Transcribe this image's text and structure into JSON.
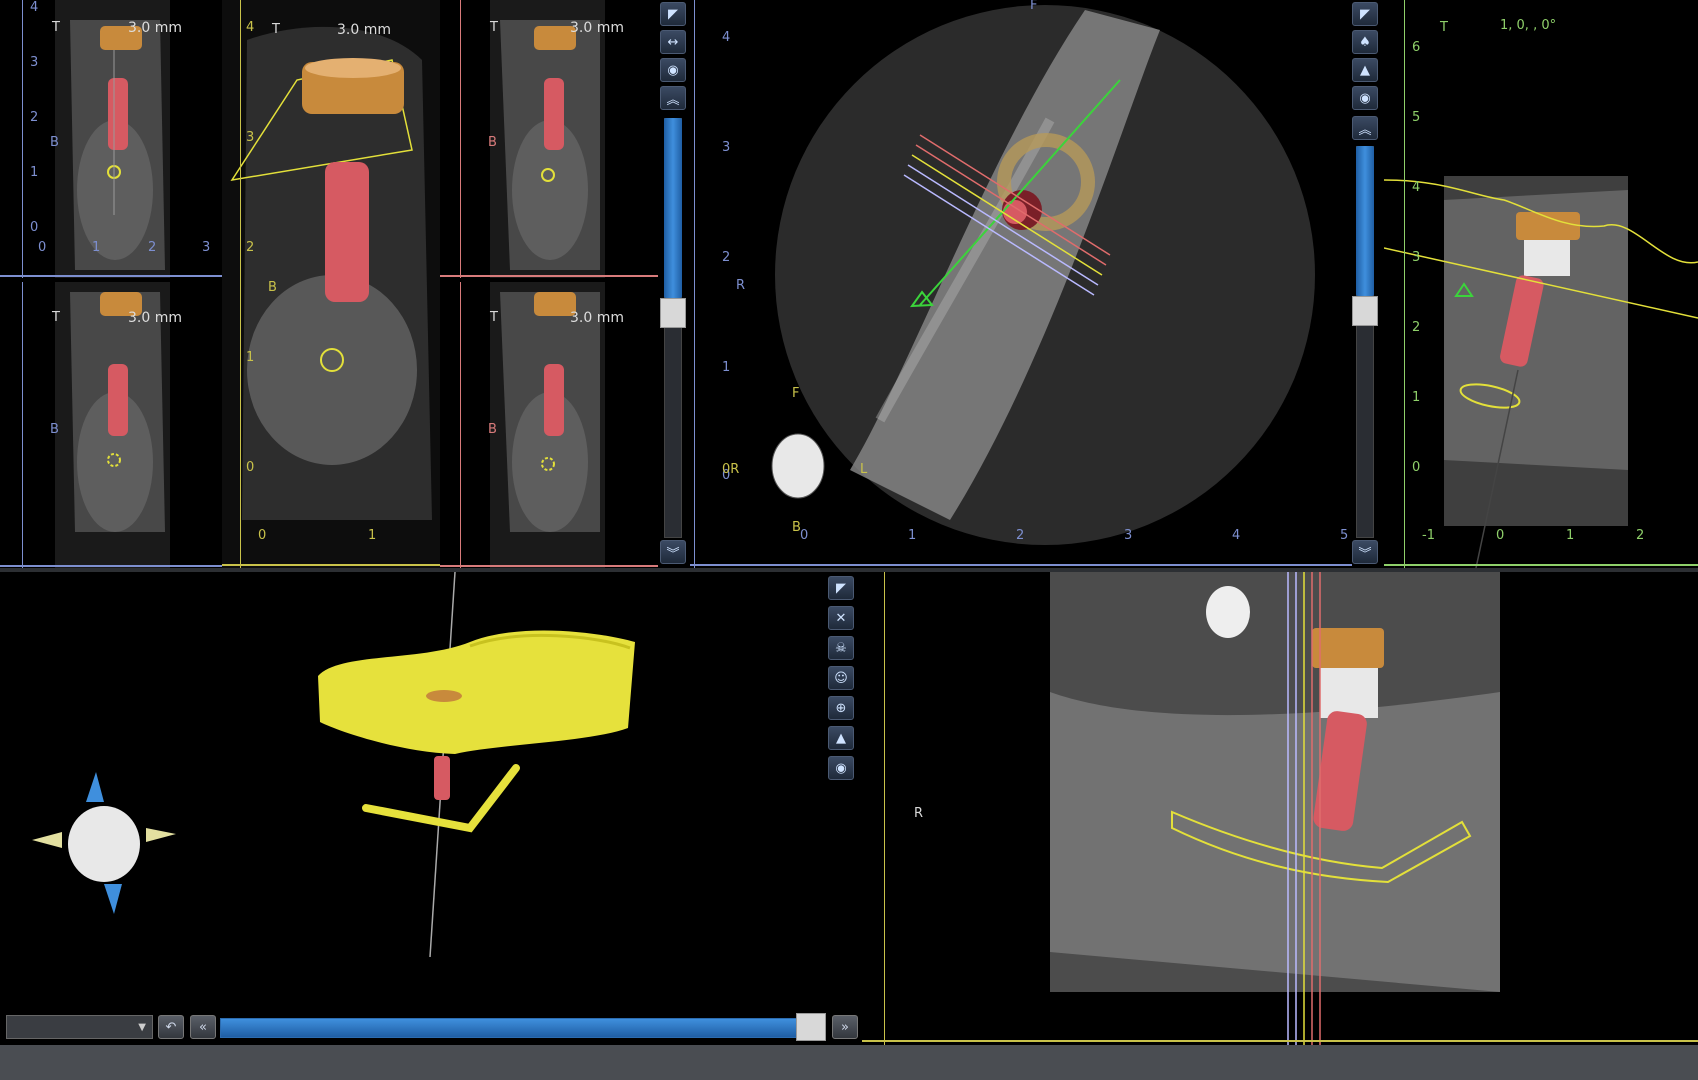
{
  "views": {
    "cross1": {
      "top_label": "T",
      "mm": "3.0 mm",
      "side_label": "B"
    },
    "cross_main": {
      "top_label": "T",
      "mm": "3.0 mm",
      "side_label": "B"
    },
    "cross3": {
      "top_label": "T",
      "mm": "3.0 mm",
      "side_label": "B"
    },
    "cross4": {
      "top_label": "T",
      "mm": "3.0 mm",
      "side_label": "B"
    },
    "cross5": {
      "top_label": "T",
      "mm": "3.0 mm",
      "side_label": "B"
    },
    "axial": {
      "top": "F",
      "right": "R",
      "orient_f": "F",
      "orient_r": "0R",
      "orient_l": "L",
      "orient_b": "B"
    },
    "right_top": {
      "top_label": "T",
      "angles": "1, 0, , 0°"
    },
    "panoramic": {
      "side_label": "R"
    }
  },
  "ticks": {
    "small_y": [
      "4",
      "3",
      "2",
      "1",
      "0"
    ],
    "small_x": [
      "0",
      "1",
      "2",
      "3"
    ],
    "main_y": [
      "4",
      "3",
      "2",
      "1",
      "0"
    ],
    "main_x": [
      "0",
      "1"
    ],
    "axial_y": [
      "4",
      "3",
      "2",
      "1",
      "0"
    ],
    "axial_x": [
      "0",
      "1",
      "2",
      "3",
      "4",
      "5"
    ],
    "right_y": [
      "6",
      "5",
      "4",
      "3",
      "2",
      "1",
      "0"
    ],
    "right_x": [
      "-1",
      "0",
      "1",
      "2"
    ]
  },
  "icons": {
    "tools_left": [
      "arrow-icon",
      "measure-icon",
      "eye-icon",
      "up-chevron-icon"
    ],
    "tools_mid": [
      "arrow-icon",
      "tooth-icon",
      "terrain-icon",
      "eye-icon",
      "up-chevron-icon"
    ],
    "tools_3d": [
      "arrow-icon",
      "crop-icon",
      "skull-icon",
      "face-icon",
      "target-icon",
      "terrain-icon",
      "eye-icon"
    ]
  },
  "colors": {
    "accent_blue": "#3f8fdd",
    "implant_red": "#d65a62",
    "abutment_gold": "#c88a3c",
    "guide_yellow": "#e3e03a",
    "model_yellow": "#e6e13c"
  },
  "bottom": {
    "dropdown_value": "",
    "slider_level": 0.92
  }
}
